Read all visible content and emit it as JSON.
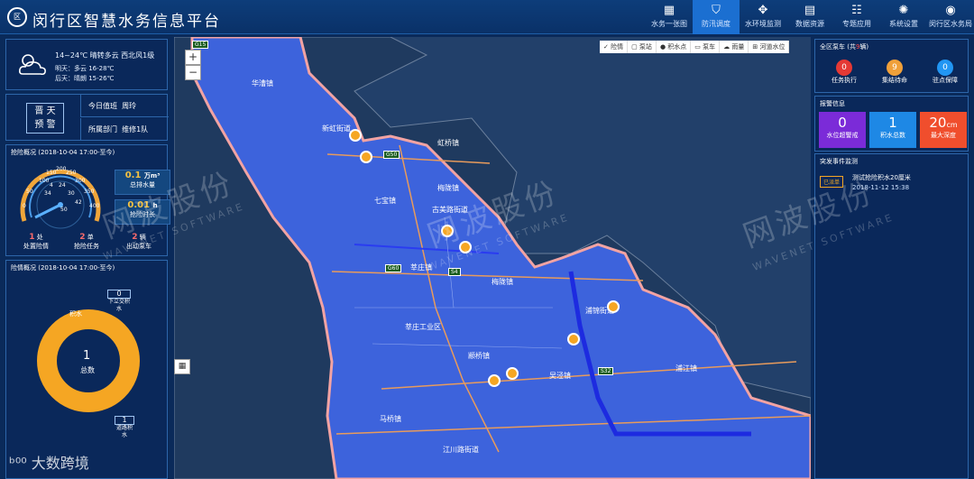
{
  "header": {
    "logo": "区",
    "title": "闵行区智慧水务信息平台"
  },
  "nav": [
    {
      "label": "水务一张图",
      "icon": "map-icon",
      "glyph": "▦"
    },
    {
      "label": "防汛调度",
      "icon": "shield-icon",
      "glyph": "⛉"
    },
    {
      "label": "水环境监测",
      "icon": "monitor-icon",
      "glyph": "✥"
    },
    {
      "label": "数据资源",
      "icon": "database-icon",
      "glyph": "▤"
    },
    {
      "label": "专题应用",
      "icon": "grid-icon",
      "glyph": "☷"
    },
    {
      "label": "系统设置",
      "icon": "gear-icon",
      "glyph": "✺"
    },
    {
      "label": "闵行区水务局",
      "icon": "user-icon",
      "glyph": "◉"
    }
  ],
  "weather": {
    "temp": "14~24℃ 晴转多云 西北风1级",
    "tomorrow": "明天：多云 16-28℃",
    "after": "后天：晴朗 15-26℃"
  },
  "duty": {
    "badge_line1": "晋 天",
    "badge_line2": "预 警",
    "row1": "今日值班",
    "row1_val": "周玲",
    "row2": "所属部门",
    "row2_val": "维修1队"
  },
  "rescue": {
    "title": "抢险概况 (2018-10-04 17:00-至今)",
    "gauge_ticks": [
      "100",
      "150",
      "200",
      "250",
      "300",
      "350",
      "400",
      "0",
      "50",
      "4",
      "24",
      "34",
      "30",
      "42",
      "50"
    ],
    "drain": "0.1",
    "drain_unit": "万m³",
    "drain_label": "总排水量",
    "time": "0.01",
    "time_unit": "h",
    "time_label": "抢险时长",
    "count1": "1",
    "count1_unit": "处",
    "count1_label": "处置险情",
    "count2": "2",
    "count2_unit": "单",
    "count2_label": "抢险任务",
    "count3": "2",
    "count3_unit": "辆",
    "count3_label": "出动泵车"
  },
  "danger": {
    "title": "险情概况 (2018-10-04 17:00-至今)",
    "label_a": "0",
    "label_a_name": "下立交积水",
    "label_b": "1",
    "label_b_name": "道路积水",
    "total": "1",
    "total_label": "总数",
    "donut_name": "积水"
  },
  "pumps": {
    "title": "全区泵车",
    "count_prefix": "(共",
    "count": "9",
    "count_suffix": "辆)",
    "items": [
      {
        "value": "0",
        "label": "任务执行",
        "color": "#e53935"
      },
      {
        "value": "9",
        "label": "集结待命",
        "color": "#f0a03a"
      },
      {
        "value": "0",
        "label": "驻点保障",
        "color": "#2196f3"
      }
    ]
  },
  "alarm": {
    "title": "报警信息",
    "items": [
      {
        "value": "0",
        "label": "水位超警戒",
        "color": "#7b2bd8"
      },
      {
        "value": "1",
        "label": "积水总数",
        "color": "#1e88e5"
      },
      {
        "value": "20",
        "unit": "cm",
        "label": "最大深度",
        "color": "#f04e2d"
      }
    ]
  },
  "events": {
    "title": "突发事件监测",
    "status": "已派单",
    "text": "测试抢险积水20厘米",
    "time": "2018-11-12 15:38"
  },
  "map": {
    "zoom_in": "+",
    "zoom_out": "−",
    "legend": [
      "✓ 险情",
      "▢ 泵站",
      "● 积水点",
      "▭ 泵车",
      "☁ 雨量",
      "⊞ 河道水位"
    ],
    "labels": [
      "华漕镇",
      "新虹街道",
      "虹桥镇",
      "七宝镇",
      "梅陇镇",
      "古美路街道",
      "莘庄镇",
      "梅陇镇",
      "莘庄工业区",
      "颛桥镇",
      "吴泾镇",
      "马桥镇",
      "江川路街道",
      "浦江镇",
      "浦锦街道"
    ],
    "roads": [
      "G15",
      "G50",
      "G60",
      "S4",
      "S32"
    ]
  },
  "watermark": {
    "brand": "网波股份",
    "en": "WAVENET SOFTWARE",
    "footer": "大数跨境"
  }
}
